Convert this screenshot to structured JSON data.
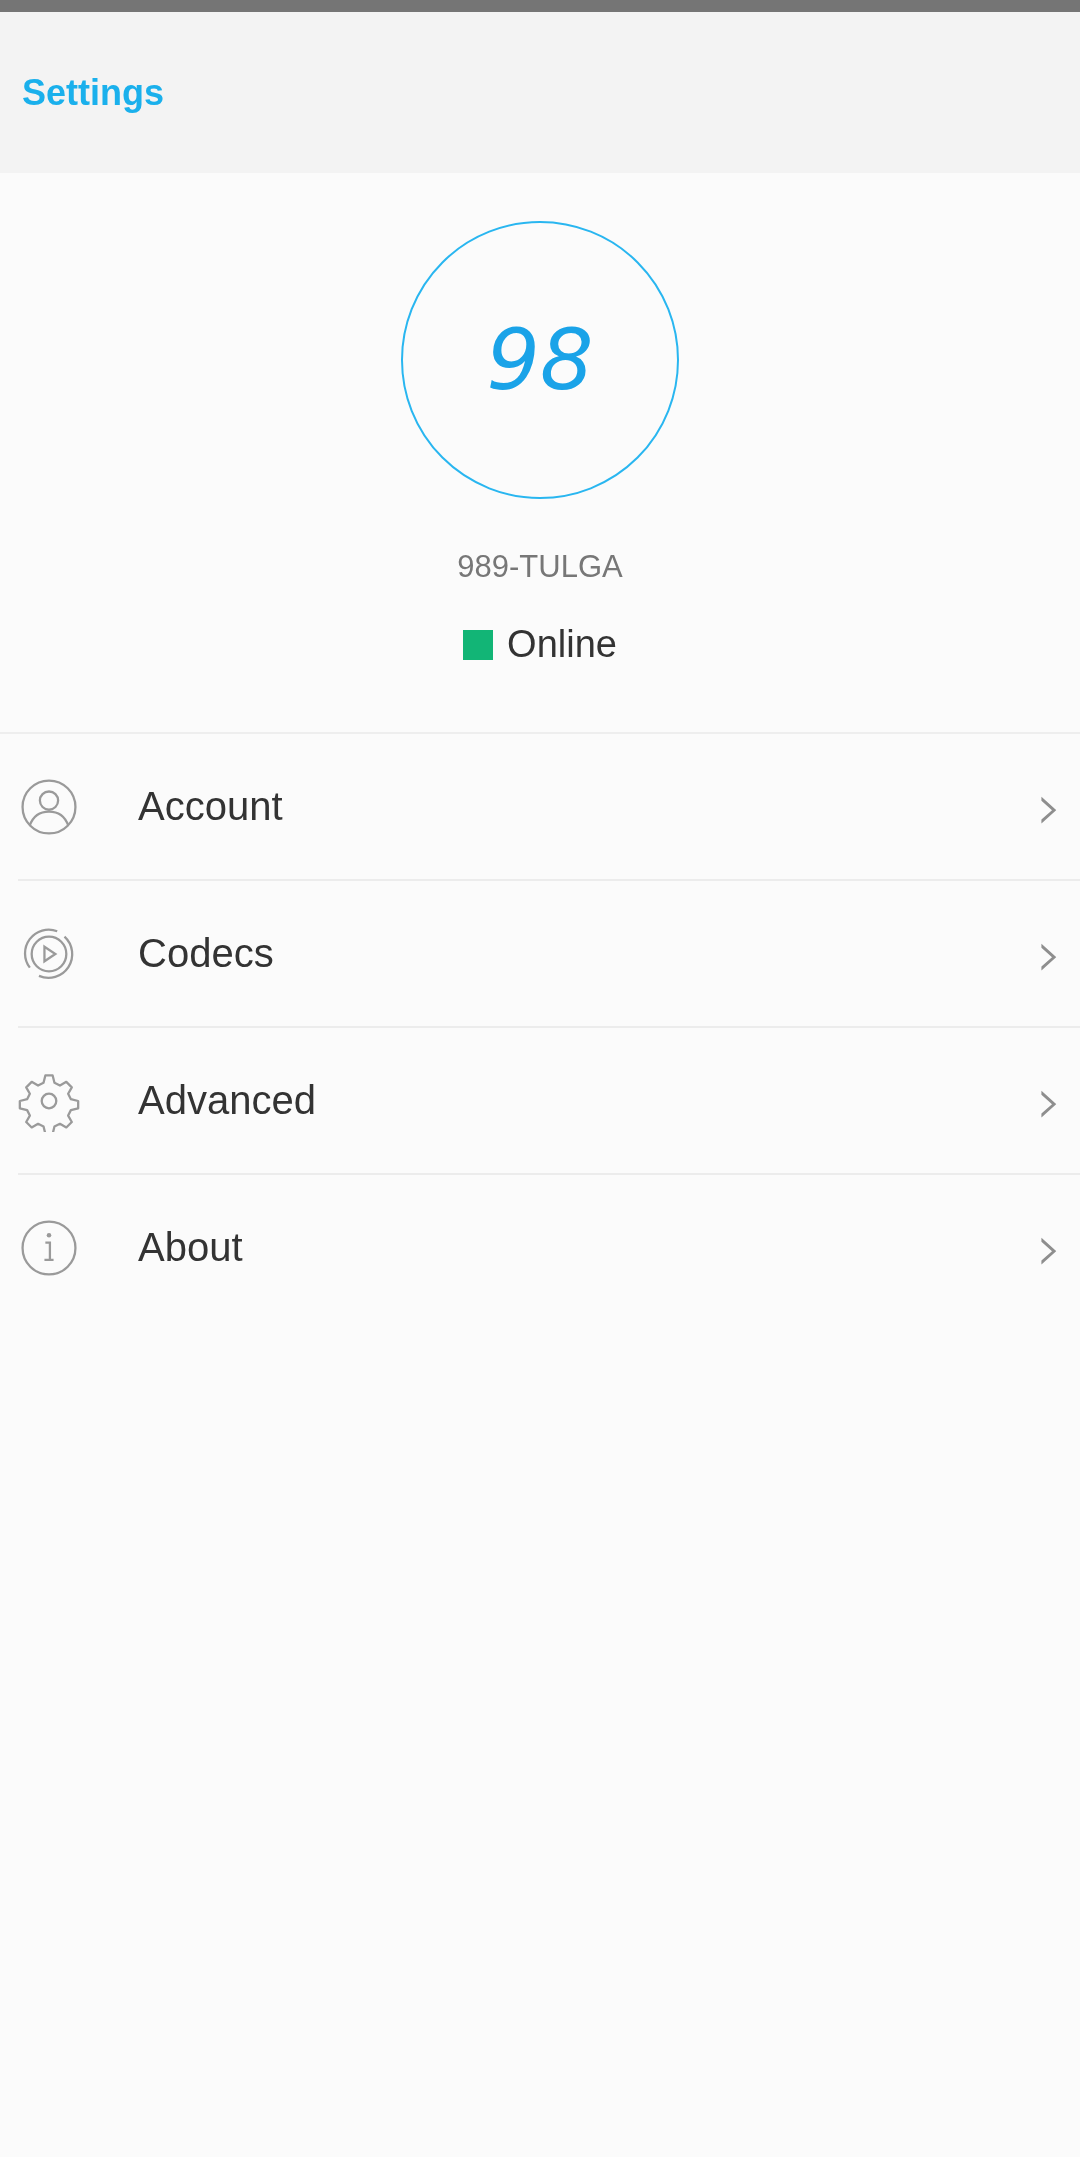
{
  "header": {
    "title": "Settings"
  },
  "profile": {
    "score": "98",
    "name": "989-TULGA",
    "status": "Online",
    "online": true
  },
  "menu": [
    {
      "label": "Account",
      "chevron": "›"
    },
    {
      "label": "Codecs",
      "chevron": "›"
    },
    {
      "label": "Advanced",
      "chevron": "›"
    },
    {
      "label": "About",
      "chevron": "›"
    }
  ]
}
